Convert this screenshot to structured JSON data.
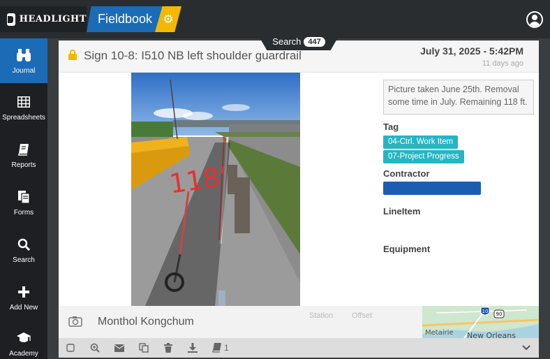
{
  "app": {
    "brand": "HeadLight",
    "brand_display": "HEADLIGHT",
    "module": "Fieldbook",
    "colors": {
      "primary": "#1c6bb7",
      "accent": "#f5b800",
      "tag": "#26b5c3",
      "dark": "#2a2d30"
    }
  },
  "sidebar": {
    "items": [
      {
        "label": "Journal",
        "icon": "binoculars-icon",
        "active": true
      },
      {
        "label": "Spreadsheets",
        "icon": "grid-icon"
      },
      {
        "label": "Reports",
        "icon": "book-icon"
      },
      {
        "label": "Forms",
        "icon": "forms-icon"
      },
      {
        "label": "Search",
        "icon": "search-icon"
      },
      {
        "label": "Add New",
        "icon": "plus-icon"
      },
      {
        "label": "Academy",
        "icon": "graduation-cap-icon"
      }
    ]
  },
  "search_tab": {
    "label": "Search",
    "count": "447"
  },
  "entry": {
    "title": "Sign 10-8: I510 NB left shoulder guardrail",
    "date": "July 31, 2025 - 5:42PM",
    "ago": "11 days ago",
    "note": "Picture taken June 25th. Removal some time in July. Remaining 118 ft.",
    "tag_label": "Tag",
    "tags": [
      "04-Ctrl. Work Item",
      "07-Project Progress"
    ],
    "contractor_label": "Contractor",
    "contractor_value": "",
    "lineitem_label": "LineItem",
    "equipment_label": "Equipment",
    "photo_annotation": "118'",
    "author": "Monthol Kongchum",
    "station_label": "Station",
    "offset_label": "Offset"
  },
  "map": {
    "labels": [
      "Metairie",
      "New Orleans"
    ],
    "shields": [
      "10",
      "90"
    ]
  },
  "toolbar": {
    "items": [
      "checkbox-icon",
      "zoom-in-icon",
      "email-icon",
      "copy-icon",
      "trash-icon",
      "download-icon",
      "book-icon"
    ],
    "book_count": "1"
  }
}
